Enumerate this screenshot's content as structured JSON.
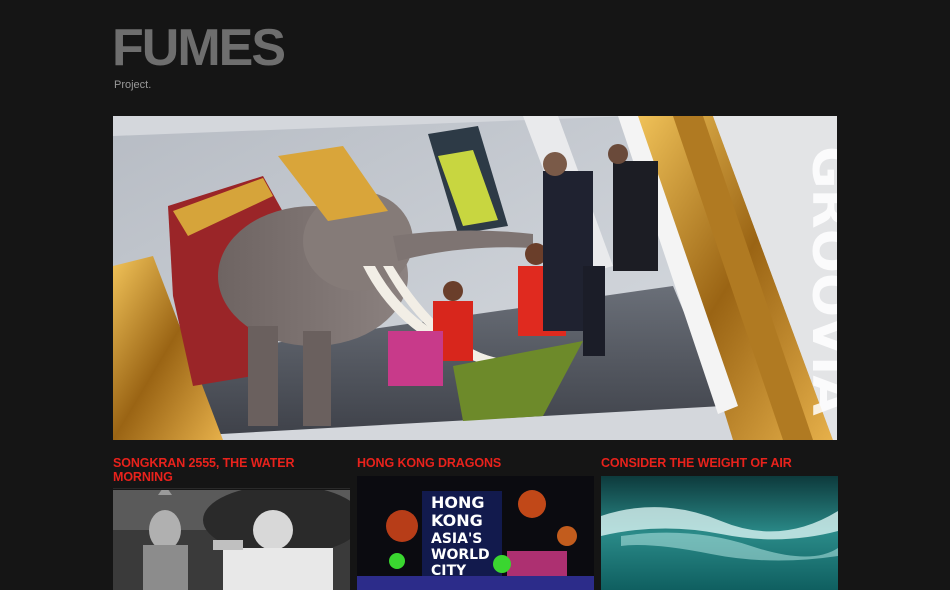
{
  "site": {
    "title": "FUMES",
    "tagline": "Project."
  },
  "hero": {
    "watermark": "GROOVIA"
  },
  "posts": [
    {
      "title": "SONGKRAN 2555, THE WATER MORNING"
    },
    {
      "title": "HONG KONG DRAGONS",
      "sign_lines": [
        "HONG",
        "KONG",
        "ASIA'S",
        "WORLD",
        "CITY"
      ]
    },
    {
      "title": "CONSIDER THE WEIGHT OF AIR"
    }
  ],
  "colors": {
    "background": "#151515",
    "post_title": "#e8221c",
    "logo": "#6e6e6e"
  }
}
